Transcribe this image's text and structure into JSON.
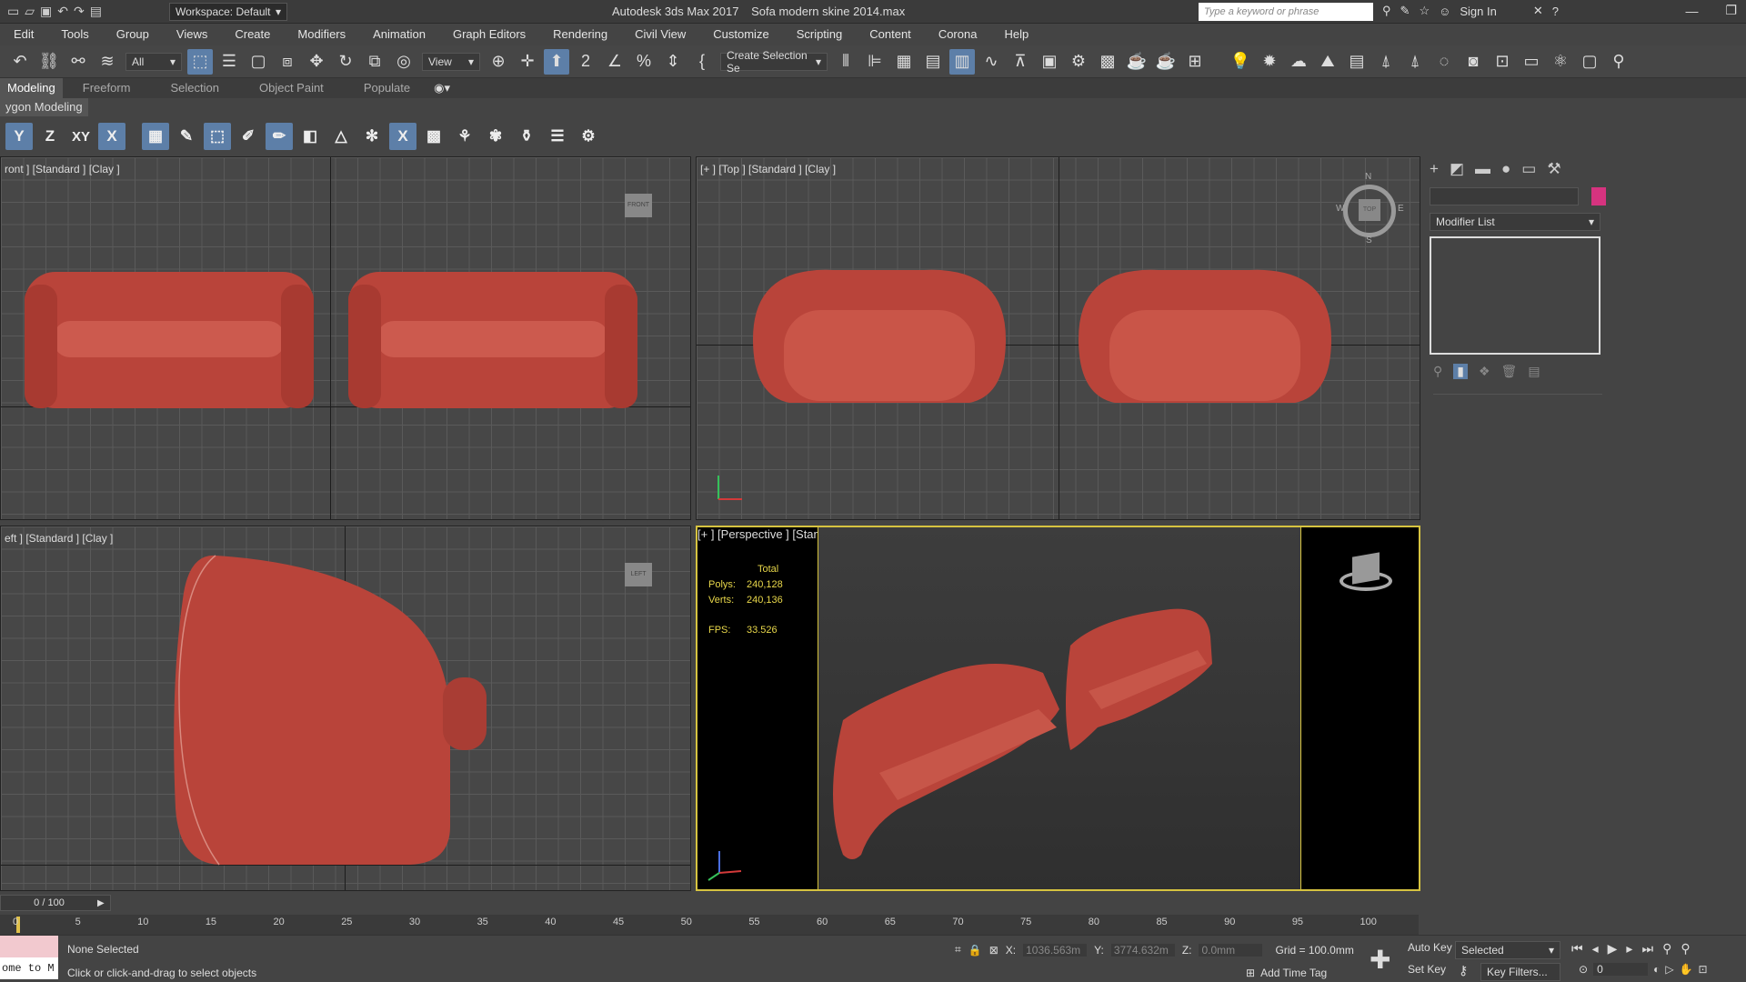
{
  "titlebar": {
    "workspace": "Workspace: Default",
    "app": "Autodesk 3ds Max 2017",
    "file": "Sofa modern skine 2014.max",
    "search_placeholder": "Type a keyword or phrase",
    "sign_in": "Sign In"
  },
  "menu": [
    "Edit",
    "Tools",
    "Group",
    "Views",
    "Create",
    "Modifiers",
    "Animation",
    "Graph Editors",
    "Rendering",
    "Civil View",
    "Customize",
    "Scripting",
    "Content",
    "Corona",
    "Help"
  ],
  "toolbar": {
    "filter": "All",
    "ref_coord": "View",
    "selection_set": "Create Selection Se",
    "icons": [
      "undo-icon",
      "link-icon",
      "unlink-icon",
      "bind-icon",
      "select-icon",
      "select-by-name-icon",
      "rect-region-icon",
      "window-crossing-icon",
      "move-icon",
      "rotate-icon",
      "scale-icon",
      "placement-icon",
      "pivot-icon",
      "snap-icon",
      "angle-snap-icon",
      "percent-snap-icon",
      "spinner-snap-icon",
      "named-sets-icon",
      "mirror-icon",
      "align-icon",
      "layer-icon",
      "scene-explorer-icon",
      "ribbon-icon",
      "curve-editor-icon",
      "schematic-icon",
      "material-editor-icon",
      "render-setup-icon",
      "render-frame-icon",
      "render-icon",
      "render-iterative-icon",
      "light-icon",
      "sun-icon",
      "sky-icon",
      "camera-icon",
      "text-icon",
      "proxy-icon",
      "scatter-icon",
      "env-icon",
      "lightmix-icon",
      "vfb-icon",
      "converter-icon",
      "material-lib-icon",
      "frame-buffer-icon"
    ]
  },
  "ribbon": {
    "tabs": [
      "Modeling",
      "Freeform",
      "Selection",
      "Object Paint",
      "Populate"
    ],
    "active_tab": "Modeling",
    "panel_label": "ygon Modeling",
    "constraint_buttons": [
      "Y",
      "Z",
      "XY",
      "X"
    ]
  },
  "viewports": {
    "front": {
      "label": "ront ] [Standard ] [Clay ]",
      "cube": "FRONT"
    },
    "top": {
      "label": "[+ ] [Top ] [Standard ] [Clay ]",
      "compass": {
        "n": "N",
        "s": "S",
        "w": "W",
        "e": "E",
        "cube": "TOP"
      }
    },
    "left": {
      "label": "eft ] [Standard ] [Clay ]",
      "cube": "LEFT"
    },
    "perspective": {
      "label": "[+ ] [Perspective ] [Standard ] [Clay ]",
      "stats": {
        "total": "Total",
        "polys_label": "Polys:",
        "polys": "240,128",
        "verts_label": "Verts:",
        "verts": "240,136",
        "fps_label": "FPS:",
        "fps": "33.526"
      }
    }
  },
  "command_panel": {
    "tabs": [
      "create-icon",
      "modify-icon",
      "hierarchy-icon",
      "motion-icon",
      "display-icon",
      "utilities-icon"
    ],
    "modifier_list": "Modifier List",
    "name_color": "#d6337f"
  },
  "timeline": {
    "frame": "0 / 100",
    "ticks": [
      "0",
      "5",
      "10",
      "15",
      "20",
      "25",
      "30",
      "35",
      "40",
      "45",
      "50",
      "55",
      "60",
      "65",
      "70",
      "75",
      "80",
      "85",
      "90",
      "95",
      "100"
    ]
  },
  "status": {
    "maxscript": "ome to M",
    "selection": "None Selected",
    "prompt": "Click or click-and-drag to select objects",
    "x_label": "X:",
    "x": "1036.563m",
    "y_label": "Y:",
    "y": "3774.632m",
    "z_label": "Z:",
    "z": "0.0mm",
    "grid": "Grid = 100.0mm",
    "add_time_tag": "Add Time Tag",
    "auto_key": "Auto Key",
    "set_key": "Set Key",
    "selected": "Selected",
    "key_filters": "Key Filters...",
    "frame_value": "0"
  },
  "colors": {
    "accent": "#5d7fa8",
    "sofa": "#b9443a",
    "active_viewport_border": "#d6c340",
    "stats_text": "#e8d74a"
  }
}
